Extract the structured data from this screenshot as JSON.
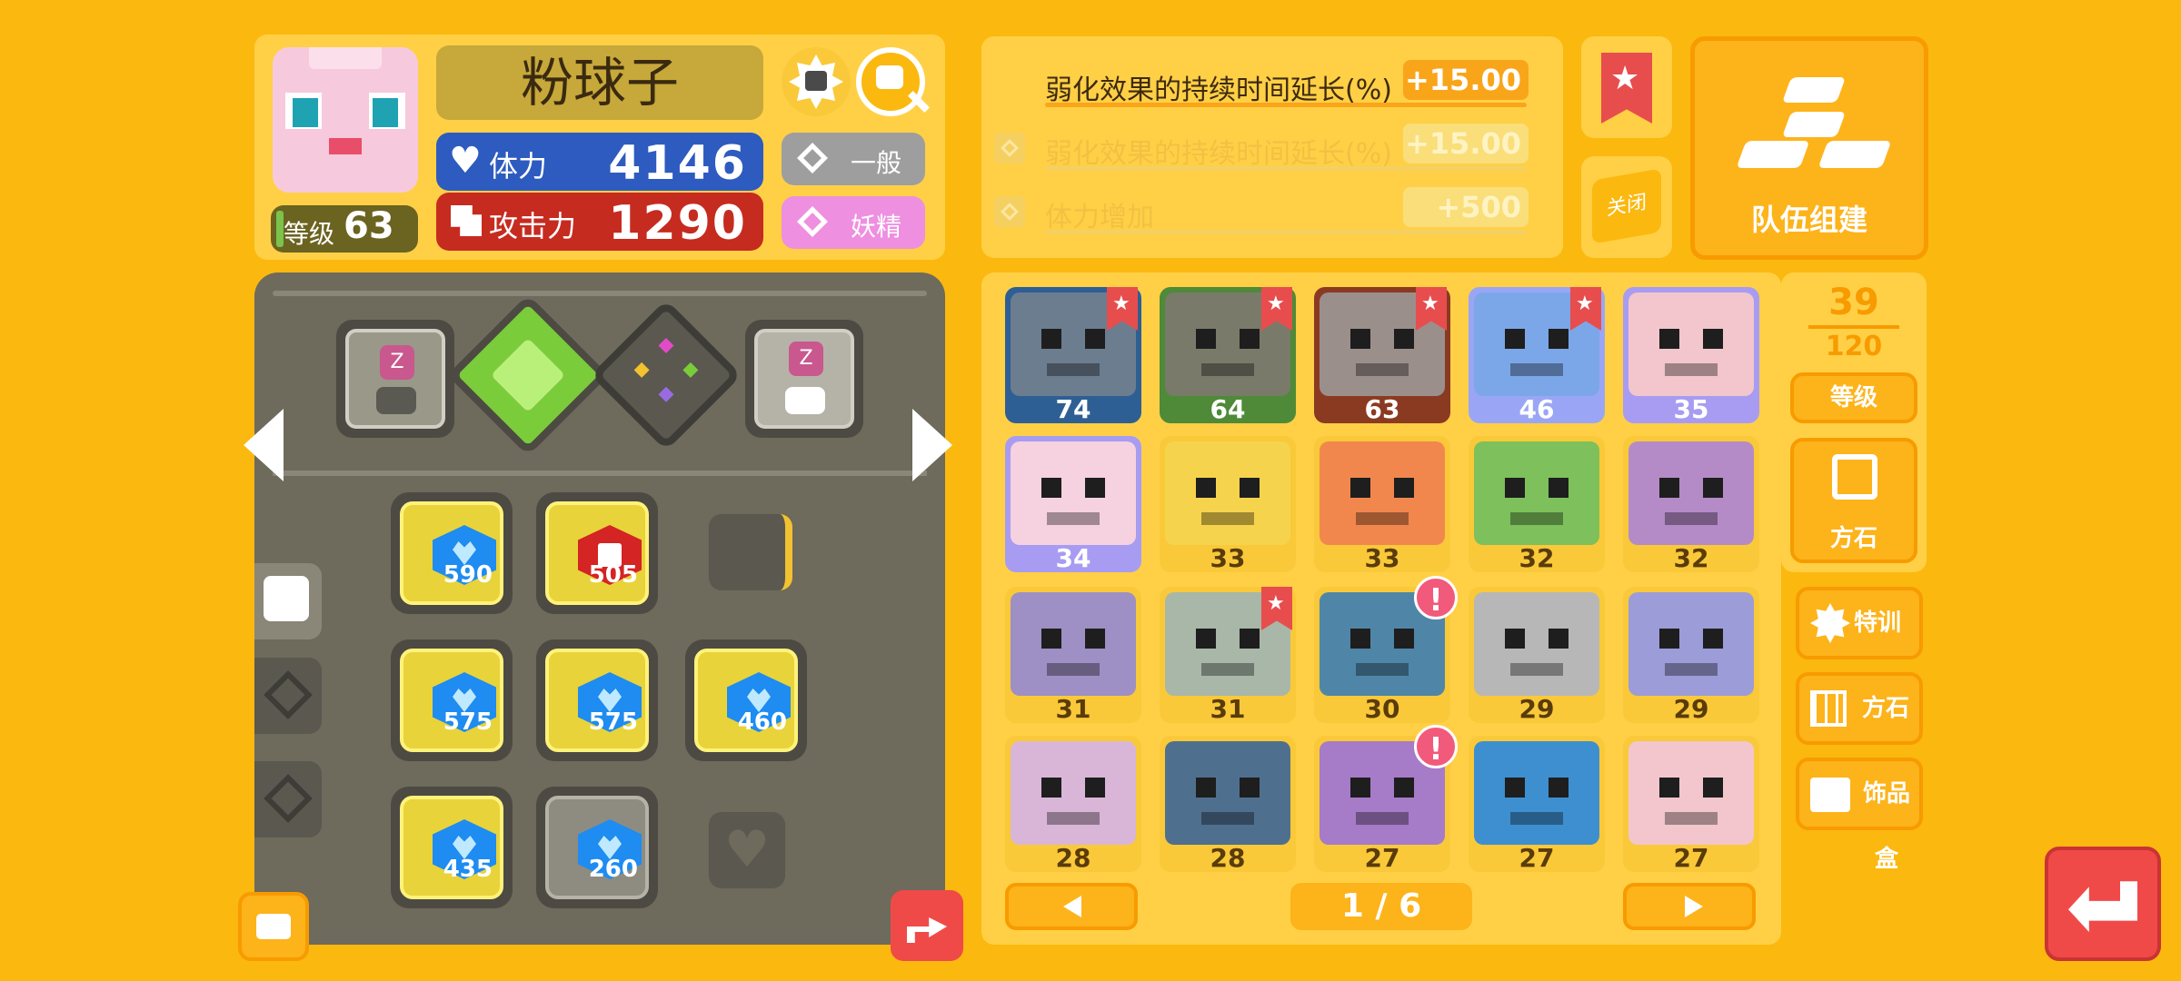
{
  "header": {
    "name": "粉球子",
    "level_label": "等级",
    "level_value": "63",
    "hp_label": "体力",
    "hp_value": "4146",
    "atk_label": "攻击力",
    "atk_value": "1290",
    "type_normal": "一般",
    "type_fairy": "妖精"
  },
  "effects": {
    "rows": [
      {
        "label": "弱化效果的持续时间延长(%)",
        "value": "+15.00",
        "active": true
      },
      {
        "label": "弱化效果的持续时间延长(%)",
        "value": "+15.00",
        "active": false
      },
      {
        "label": "体力增加",
        "value": "+500",
        "active": false
      }
    ],
    "close_label": "关闭",
    "team_label": "队伍组建"
  },
  "board": {
    "stones": [
      "590",
      "505",
      "575",
      "575",
      "460",
      "435",
      "260"
    ]
  },
  "grid": {
    "cells": [
      {
        "lv": "74",
        "color": "#2E5F94",
        "flag": true,
        "alert": false,
        "dark": true
      },
      {
        "lv": "64",
        "color": "#4E8A38",
        "flag": true,
        "alert": false,
        "dark": true
      },
      {
        "lv": "63",
        "color": "#8B3A22",
        "flag": true,
        "alert": false,
        "dark": true
      },
      {
        "lv": "46",
        "color": "#9AA6F5",
        "flag": true,
        "alert": false,
        "dark": true
      },
      {
        "lv": "35",
        "color": "#A79CF2",
        "flag": false,
        "alert": false,
        "dark": true
      },
      {
        "lv": "34",
        "color": "#A79CF2",
        "flag": false,
        "alert": false,
        "dark": true
      },
      {
        "lv": "33",
        "color": "#F9C93A",
        "flag": false,
        "alert": false,
        "dark": false
      },
      {
        "lv": "33",
        "color": "#F9C93A",
        "flag": false,
        "alert": false,
        "dark": false
      },
      {
        "lv": "32",
        "color": "#F9C93A",
        "flag": false,
        "alert": false,
        "dark": false
      },
      {
        "lv": "32",
        "color": "#F9C93A",
        "flag": false,
        "alert": false,
        "dark": false
      },
      {
        "lv": "31",
        "color": "#F9C93A",
        "flag": false,
        "alert": false,
        "dark": false
      },
      {
        "lv": "31",
        "color": "#F9C93A",
        "flag": true,
        "alert": false,
        "dark": false
      },
      {
        "lv": "30",
        "color": "#F9C93A",
        "flag": false,
        "alert": true,
        "dark": false
      },
      {
        "lv": "29",
        "color": "#F9C93A",
        "flag": false,
        "alert": false,
        "dark": false
      },
      {
        "lv": "29",
        "color": "#F9C93A",
        "flag": false,
        "alert": false,
        "dark": false
      },
      {
        "lv": "28",
        "color": "#F9C93A",
        "flag": false,
        "alert": false,
        "dark": false
      },
      {
        "lv": "28",
        "color": "#F9C93A",
        "flag": false,
        "alert": false,
        "dark": false
      },
      {
        "lv": "27",
        "color": "#F9C93A",
        "flag": false,
        "alert": true,
        "dark": false
      },
      {
        "lv": "27",
        "color": "#F9C93A",
        "flag": false,
        "alert": false,
        "dark": false
      },
      {
        "lv": "27",
        "color": "#F9C93A",
        "flag": false,
        "alert": false,
        "dark": false
      }
    ],
    "faces": [
      "#6C7D8F",
      "#7A7A6A",
      "#9B8F8C",
      "#7BA7E8",
      "#F2C6CC",
      "#F6D1E0",
      "#F6D34C",
      "#F2874E",
      "#7DC05C",
      "#B58BC7",
      "#9E8FC4",
      "#A8B7A8",
      "#4F86A8",
      "#B7B7B7",
      "#9C9CD8",
      "#D9B6D8",
      "#4F6F8F",
      "#A67BC7",
      "#3E8FCF",
      "#F2C6CC"
    ],
    "page_current": "1",
    "page_sep": "/",
    "page_total": "6"
  },
  "sidebar": {
    "count_current": "39",
    "count_total": "120",
    "sort_label": "等级",
    "stones_label": "方石",
    "training_label": "特训",
    "board_label": "方石板",
    "box_label": "饰品盒"
  }
}
